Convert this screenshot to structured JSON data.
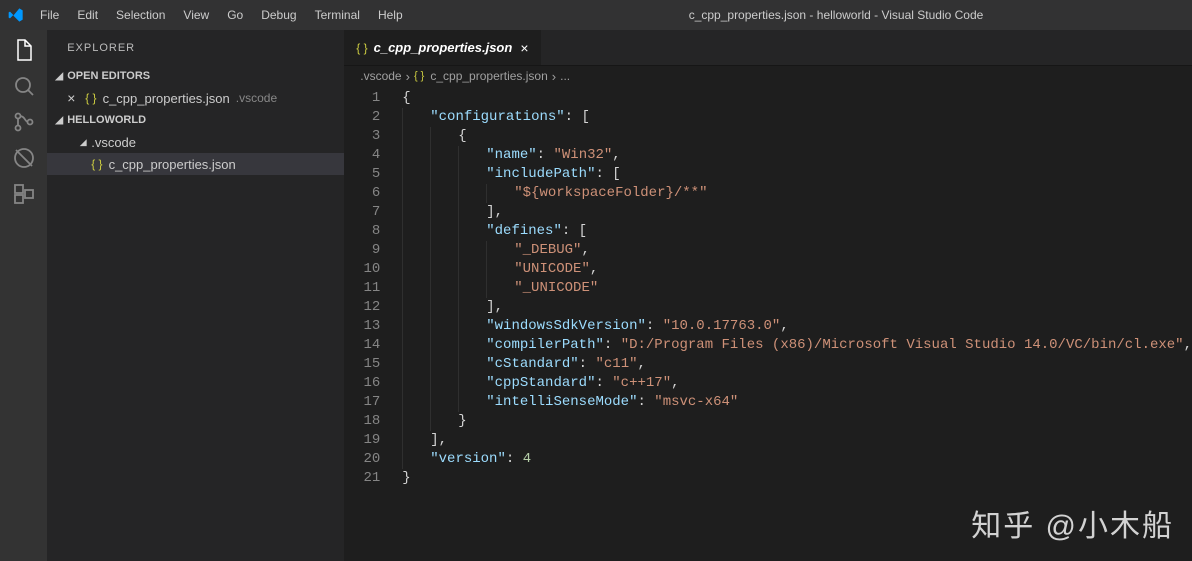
{
  "window": {
    "title": "c_cpp_properties.json - helloworld - Visual Studio Code"
  },
  "menubar": {
    "items": [
      "File",
      "Edit",
      "Selection",
      "View",
      "Go",
      "Debug",
      "Terminal",
      "Help"
    ]
  },
  "sidebar": {
    "header": "EXPLORER",
    "openEditors": {
      "title": "OPEN EDITORS",
      "file": "c_cpp_properties.json",
      "dir": ".vscode"
    },
    "workspace": {
      "title": "HELLOWORLD",
      "folder": ".vscode",
      "file": "c_cpp_properties.json"
    }
  },
  "tab": {
    "label": "c_cpp_properties.json"
  },
  "breadcrumbs": {
    "seg1": ".vscode",
    "seg2": "c_cpp_properties.json",
    "seg3": "..."
  },
  "code": {
    "name_key": "name",
    "name_val": "Win32",
    "conf_key": "configurations",
    "inc_key": "includePath",
    "inc_val": "${workspaceFolder}/**",
    "def_key": "defines",
    "d1": "_DEBUG",
    "d2": "UNICODE",
    "d3": "_UNICODE",
    "wsdk_key": "windowsSdkVersion",
    "wsdk_val": "10.0.17763.0",
    "comp_key": "compilerPath",
    "comp_val": "D:/Program Files (x86)/Microsoft Visual Studio 14.0/VC/bin/cl.exe",
    "cstd_key": "cStandard",
    "cstd_val": "c11",
    "cppstd_key": "cppStandard",
    "cppstd_val": "c++17",
    "isense_key": "intelliSenseMode",
    "isense_val": "msvc-x64",
    "ver_key": "version",
    "ver_val": "4"
  },
  "watermark": "知乎 @小木船"
}
